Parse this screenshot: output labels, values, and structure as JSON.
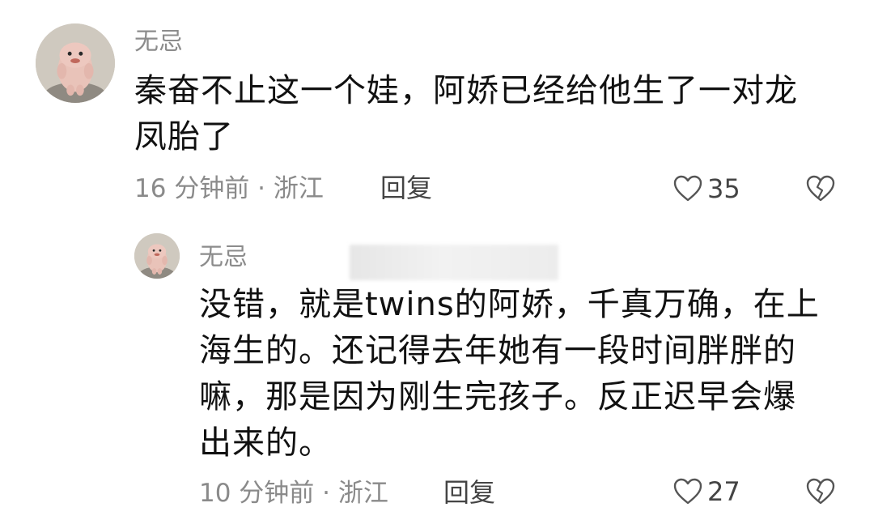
{
  "comments": [
    {
      "username": "无忌",
      "text_lines": [
        "秦奋不止这一个娃，阿娇已经给他生了一对龙",
        "凤胎了"
      ],
      "meta": "16 分钟前 · 浙江",
      "reply_label": "回复",
      "like_count": "35"
    },
    {
      "username": "无忌",
      "text_lines": [
        "没错，就是twins的阿娇，千真万确，在上",
        "海生的。还记得去年她有一段时间胖胖的",
        "嘛，那是因为刚生完孩子。反正迟早会爆",
        "出来的。"
      ],
      "meta": "10 分钟前 · 浙江",
      "reply_label": "回复",
      "like_count": "27"
    }
  ],
  "icons": {
    "like": "heart-outline-icon",
    "dislike": "broken-heart-icon",
    "avatar": "plush-toy-avatar"
  },
  "colors": {
    "username": "#8c8c8c",
    "text": "#111111",
    "meta": "#8a8a8a",
    "action": "#444444"
  }
}
